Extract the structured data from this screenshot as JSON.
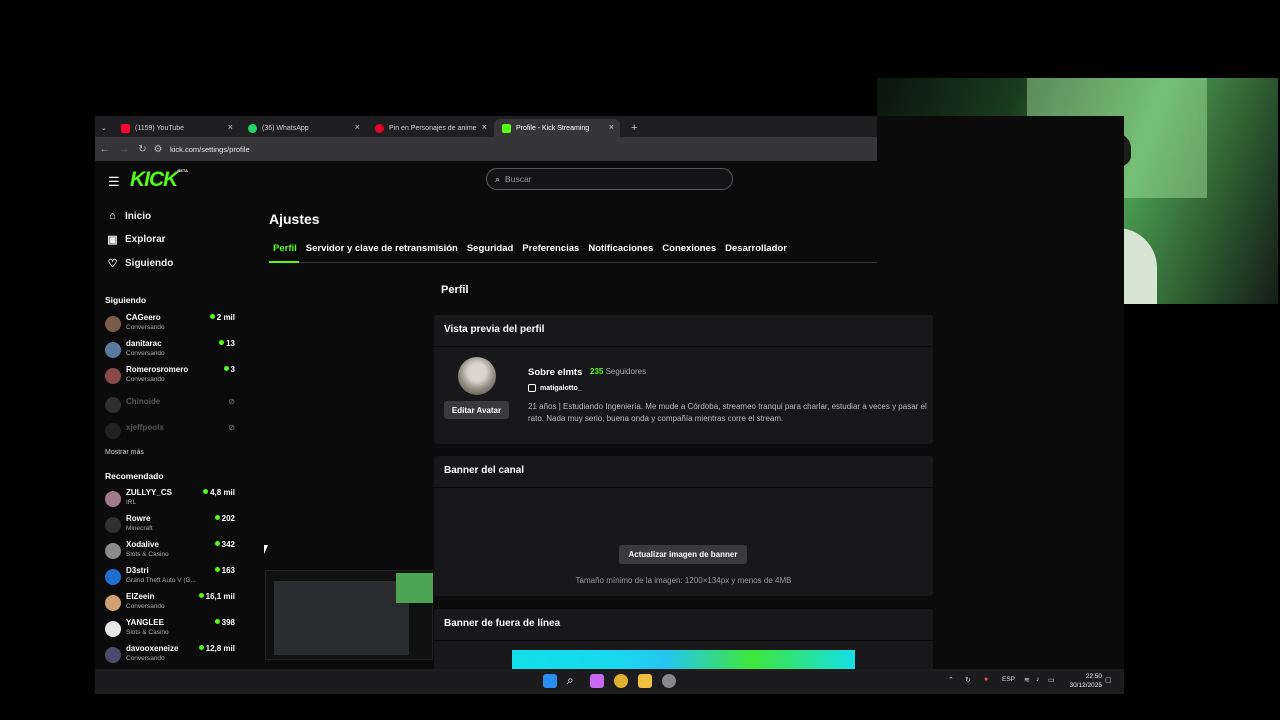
{
  "browser": {
    "tabs": [
      {
        "label": "(1159) YouTube",
        "color": "#ff0033"
      },
      {
        "label": "(36) WhatsApp",
        "color": "#25d366"
      },
      {
        "label": "Pin en Personajes de anime",
        "color": "#e60023"
      },
      {
        "label": "Profile - Kick Streaming",
        "color": "#53fc18"
      }
    ],
    "url": "kick.com/settings/profile"
  },
  "header": {
    "logo": "KICK",
    "logo_badge": "BETA",
    "search_placeholder": "Buscar"
  },
  "sidebar": {
    "nav": [
      {
        "label": "Inicio",
        "icon": "home-icon"
      },
      {
        "label": "Explorar",
        "icon": "compass-icon"
      },
      {
        "label": "Siguiendo",
        "icon": "heart-icon"
      }
    ],
    "following_title": "Siguiendo",
    "following": [
      {
        "name": "CAGeero",
        "sub": "Conversando",
        "viewers": "2 mil"
      },
      {
        "name": "danitarac",
        "sub": "Conversando",
        "viewers": "13"
      },
      {
        "name": "Romerosromero",
        "sub": "Conversando",
        "viewers": "3"
      },
      {
        "name": "Chinoide",
        "sub": "",
        "viewers": ""
      },
      {
        "name": "xjeffpoolx",
        "sub": "",
        "viewers": ""
      }
    ],
    "show_more": "Mostrar más",
    "recommended_title": "Recomendado",
    "recommended": [
      {
        "name": "ZULLYY_CS",
        "sub": "IRL",
        "viewers": "4,8 mil"
      },
      {
        "name": "Rowre",
        "sub": "Minecraft",
        "viewers": "202"
      },
      {
        "name": "Xodalive",
        "sub": "Slots & Casino",
        "viewers": "342"
      },
      {
        "name": "D3stri",
        "sub": "Grand Theft Auto V (G...",
        "viewers": "163"
      },
      {
        "name": "ElZeein",
        "sub": "Conversando",
        "viewers": "16,1 mil"
      },
      {
        "name": "YANGLEE",
        "sub": "Slots & Casino",
        "viewers": "398"
      },
      {
        "name": "davooxeneize",
        "sub": "Conversando",
        "viewers": "12,8 mil"
      }
    ]
  },
  "settings": {
    "title": "Ajustes",
    "tabs": [
      "Perfil",
      "Servidor y clave de retransmisión",
      "Seguridad",
      "Preferencias",
      "Notificaciones",
      "Conexiones",
      "Desarrollador"
    ],
    "section_title": "Perfil",
    "preview": {
      "title": "Vista previa del perfil",
      "edit_avatar": "Editar Avatar",
      "about": "Sobre elmts",
      "followers_count": "235",
      "followers_label": "Seguidores",
      "instagram": "matigalotto_",
      "bio": "21 años | Estudiando Ingeniería. Me mude a Córdoba, streameo tranqui para charlar, estudiar a veces y pasar el rato. Nada muy serio, buena onda y compañía mientras corre el stream."
    },
    "banner": {
      "title": "Banner del canal",
      "button": "Actualizar imagen de banner",
      "hint": "Tamaño mínimo de la imagen: 1200×134px y menos de 4MB"
    },
    "offline": {
      "title": "Banner de fuera de línea"
    }
  },
  "taskbar": {
    "lang": "ESP",
    "time": "22:50",
    "date": "30/12/2025"
  }
}
